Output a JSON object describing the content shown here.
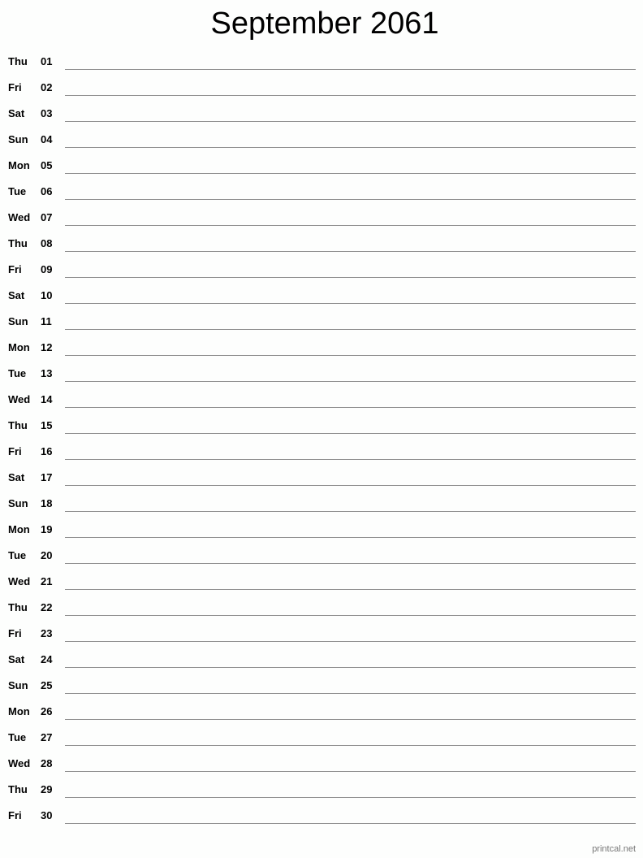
{
  "title": "September 2061",
  "days": [
    {
      "dow": "Thu",
      "num": "01"
    },
    {
      "dow": "Fri",
      "num": "02"
    },
    {
      "dow": "Sat",
      "num": "03"
    },
    {
      "dow": "Sun",
      "num": "04"
    },
    {
      "dow": "Mon",
      "num": "05"
    },
    {
      "dow": "Tue",
      "num": "06"
    },
    {
      "dow": "Wed",
      "num": "07"
    },
    {
      "dow": "Thu",
      "num": "08"
    },
    {
      "dow": "Fri",
      "num": "09"
    },
    {
      "dow": "Sat",
      "num": "10"
    },
    {
      "dow": "Sun",
      "num": "11"
    },
    {
      "dow": "Mon",
      "num": "12"
    },
    {
      "dow": "Tue",
      "num": "13"
    },
    {
      "dow": "Wed",
      "num": "14"
    },
    {
      "dow": "Thu",
      "num": "15"
    },
    {
      "dow": "Fri",
      "num": "16"
    },
    {
      "dow": "Sat",
      "num": "17"
    },
    {
      "dow": "Sun",
      "num": "18"
    },
    {
      "dow": "Mon",
      "num": "19"
    },
    {
      "dow": "Tue",
      "num": "20"
    },
    {
      "dow": "Wed",
      "num": "21"
    },
    {
      "dow": "Thu",
      "num": "22"
    },
    {
      "dow": "Fri",
      "num": "23"
    },
    {
      "dow": "Sat",
      "num": "24"
    },
    {
      "dow": "Sun",
      "num": "25"
    },
    {
      "dow": "Mon",
      "num": "26"
    },
    {
      "dow": "Tue",
      "num": "27"
    },
    {
      "dow": "Wed",
      "num": "28"
    },
    {
      "dow": "Thu",
      "num": "29"
    },
    {
      "dow": "Fri",
      "num": "30"
    }
  ],
  "footer": "printcal.net"
}
